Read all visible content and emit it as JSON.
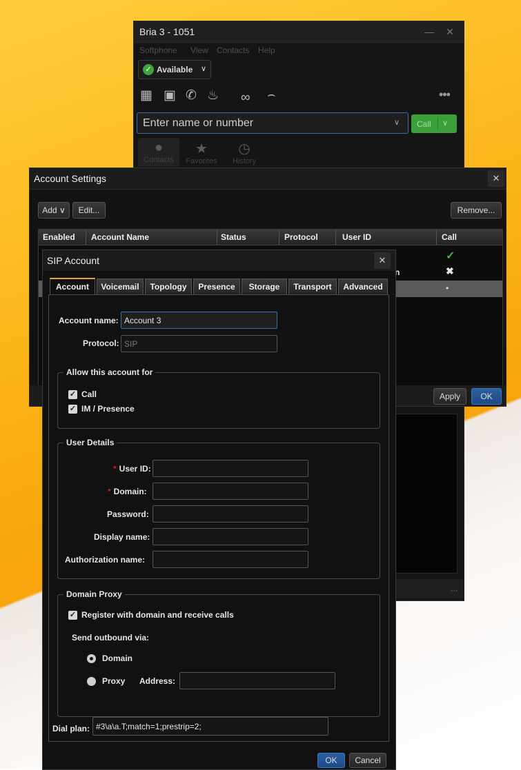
{
  "bria": {
    "title": "Bria 3 - 1051",
    "menu": [
      "Softphone",
      "View",
      "Contacts",
      "Help"
    ],
    "presence": "Available",
    "search_placeholder": "Enter name or number",
    "call_label": "Call",
    "tabs": [
      "Contacts",
      "Favorites",
      "History"
    ]
  },
  "account_settings": {
    "title": "Account Settings",
    "add_label": "Add",
    "edit_label": "Edit...",
    "remove_label": "Remove...",
    "columns": [
      "Enabled",
      "Account Name",
      "Status",
      "Protocol",
      "User ID",
      "Call"
    ],
    "partial_text": "n",
    "apply_label": "Apply",
    "ok_label": "OK"
  },
  "sip": {
    "title": "SIP Account",
    "tabs": [
      "Account",
      "Voicemail",
      "Topology",
      "Presence",
      "Storage",
      "Transport",
      "Advanced"
    ],
    "account_name_label": "Account name:",
    "account_name_value": "Account 3",
    "protocol_label": "Protocol:",
    "protocol_value": "SIP",
    "allow_title": "Allow this account for",
    "allow_call": "Call",
    "allow_im": "IM / Presence",
    "user_details_title": "User Details",
    "user_id_label": "User ID:",
    "domain_label": "Domain:",
    "password_label": "Password:",
    "display_name_label": "Display name:",
    "auth_name_label": "Authorization name:",
    "proxy_title": "Domain Proxy",
    "register_label": "Register with domain and receive calls",
    "send_via_label": "Send outbound via:",
    "domain_option": "Domain",
    "proxy_option": "Proxy",
    "address_label": "Address:",
    "dial_plan_label": "Dial plan:",
    "dial_plan_value": "#3\\a\\a.T;match=1;prestrip=2;",
    "ok_label": "OK",
    "cancel_label": "Cancel"
  }
}
